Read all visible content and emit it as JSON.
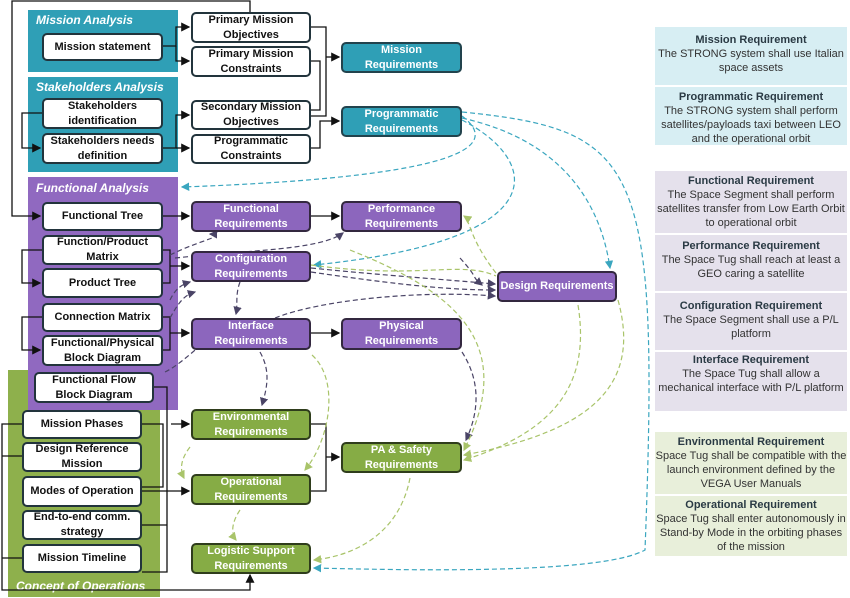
{
  "colors": {
    "teal": "#2f9fb6",
    "purple": "#8c66bd",
    "green": "#86ac45",
    "teal_light": "#d7eef3",
    "purple_light": "#e5e1ec",
    "green_light": "#e8efda"
  },
  "panels": {
    "mission_analysis": "Mission Analysis",
    "stakeholders_analysis": "Stakeholders Analysis",
    "functional_analysis": "Functional Analysis",
    "concept_of_operations": "Concept of Operations"
  },
  "inputs": {
    "mission_statement": "Mission statement",
    "stakeholders_identification": "Stakeholders identification",
    "stakeholders_needs": "Stakeholders needs definition",
    "functional_tree": "Functional Tree",
    "function_product_matrix": "Function/Product Matrix",
    "product_tree": "Product Tree",
    "connection_matrix": "Connection Matrix",
    "functional_physical_block": "Functional/Physical Block Diagram",
    "functional_flow_block": "Functional Flow Block Diagram",
    "mission_phases": "Mission Phases",
    "design_reference_mission": "Design Reference Mission",
    "modes_of_operation": "Modes of Operation",
    "end_to_end": "End-to-end comm. strategy",
    "mission_timeline": "Mission Timeline"
  },
  "intermediate": {
    "primary_objectives": "Primary Mission Objectives",
    "primary_constraints": "Primary Mission Constraints",
    "secondary_objectives": "Secondary Mission Objectives",
    "programmatic_constraints": "Programmatic Constraints"
  },
  "requirements": {
    "mission": "Mission Requirements",
    "programmatic": "Programmatic Requirements",
    "functional": "Functional Requirements",
    "performance": "Performance Requirements",
    "configuration": "Configuration Requirements",
    "design": "Design Requirements",
    "interface": "Interface Requirements",
    "physical": "Physical Requirements",
    "environmental": "Environmental Requirements",
    "pa_safety": "PA & Safety Requirements",
    "operational": "Operational Requirements",
    "logistic": "Logistic Support Requirements"
  },
  "examples": [
    {
      "title": "Mission Requirement",
      "text": "The STRONG system shall use Italian space assets"
    },
    {
      "title": "Programmatic Requirement",
      "text": "The STRONG system shall perform satellites/payloads taxi between LEO and the operational orbit"
    },
    {
      "title": "Functional Requirement",
      "text": "The Space Segment shall perform satellites transfer from Low Earth Orbit to operational orbit"
    },
    {
      "title": "Performance Requirement",
      "text": "The Space Tug shall reach at least a GEO caring a satellite"
    },
    {
      "title": "Configuration Requirement",
      "text": "The Space Segment shall use a P/L platform"
    },
    {
      "title": "Interface Requirement",
      "text": "The Space Tug shall allow a mechanical interface with P/L platform"
    },
    {
      "title": "Environmental Requirement",
      "text": "Space Tug shall be compatible with the launch environment defined by the VEGA User Manuals"
    },
    {
      "title": "Operational Requirement",
      "text": "Space Tug shall enter autonomously in Stand-by Mode in the orbiting phases of the mission"
    }
  ]
}
